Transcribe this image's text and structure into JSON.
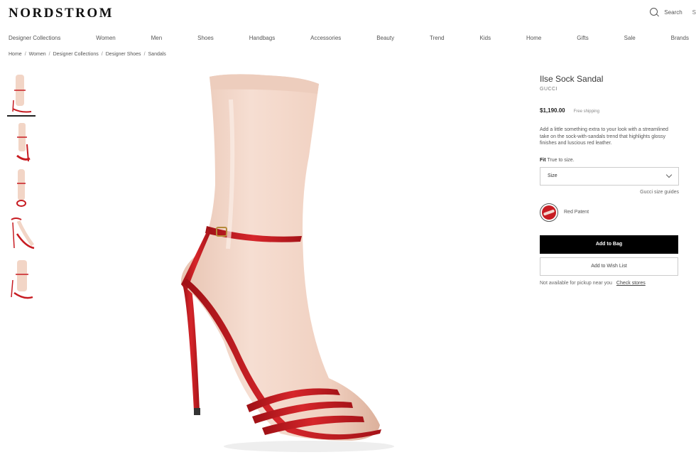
{
  "header": {
    "logo": "NORDSTROM",
    "search_label": "Search",
    "sign_in_partial": "S"
  },
  "nav": [
    "Designer Collections",
    "Women",
    "Men",
    "Shoes",
    "Handbags",
    "Accessories",
    "Beauty",
    "Trend",
    "Kids",
    "Home",
    "Gifts",
    "Sale",
    "Brands"
  ],
  "breadcrumb": [
    "Home",
    "Women",
    "Designer Collections",
    "Designer Shoes",
    "Sandals"
  ],
  "product": {
    "title": "Ilse Sock Sandal",
    "brand": "GUCCI",
    "price": "$1,190.00",
    "shipping": "Free shipping",
    "description": "Add a little something extra to your look with a streamlined take on the sock-with-sandals trend that highlights glossy finishes and luscious red leather.",
    "fit_label": "Fit",
    "fit_value": "True to size.",
    "size_placeholder": "Size",
    "size_guide": "Gucci size guides",
    "color_name": "Red Patent",
    "add_to_bag": "Add to Bag",
    "add_to_wishlist": "Add to Wish List",
    "pickup_text": "Not available for pickup near you",
    "check_stores": "Check stores"
  },
  "colors": {
    "sock": "#f2d5c6",
    "strap": "#c71c22",
    "button_bg": "#000000"
  }
}
